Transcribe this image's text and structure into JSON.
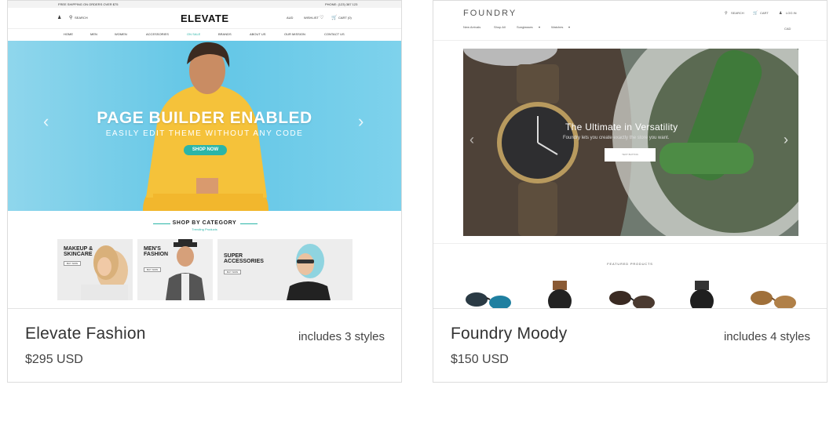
{
  "themes": [
    {
      "name": "Elevate Fashion",
      "price": "$295 USD",
      "styles": "includes 3 styles",
      "preview": {
        "topbar_left": "FREE SHIPPING ON ORDERS OVER $75",
        "topbar_right": "PHONE: (123) 387 123",
        "search_label": "SEARCH",
        "logo": "ELEVATE",
        "currency": "AUD",
        "wishlist": "WISHLIST",
        "cart": "CART (0)",
        "nav": [
          "HOME",
          "MEN",
          "WOMEN",
          "ACCESSORIES",
          "ON SALE",
          "BRANDS",
          "ABOUT US",
          "OUR MISSION",
          "CONTACT US"
        ],
        "hero_title": "PAGE BUILDER ENABLED",
        "hero_subtitle": "EASILY EDIT THEME WITHOUT ANY CODE",
        "hero_button": "SHOP NOW",
        "category_title": "SHOP BY CATEGORY",
        "category_subtitle": "Trending Products",
        "categories": [
          {
            "title_line1": "MAKEUP &",
            "title_line2": "SKINCARE",
            "button": "BUY NOW"
          },
          {
            "title_line1": "MEN'S",
            "title_line2": "FASHION",
            "button": "BUY NOW"
          },
          {
            "title_line1": "SUPER",
            "title_line2": "ACCESSORIES",
            "button": "BUY NOW"
          }
        ],
        "accent_color": "#2bb5a8"
      }
    },
    {
      "name": "Foundry Moody",
      "price": "$150 USD",
      "styles": "includes 4 styles",
      "preview": {
        "logo": "FOUNDRY",
        "nav": [
          "New Arrivals",
          "Shop All",
          "Sunglasses",
          "Watches"
        ],
        "search": "SEARCH",
        "cart": "CART",
        "login": "LOG IN",
        "currency": "CAD",
        "hero_title": "The Ultimate in Versatility",
        "hero_subtitle": "Foundry lets you create exactly the store you want.",
        "hero_button": "TEXT BUTTON",
        "featured_label": "FEATURED PRODUCTS",
        "products": [
          "sunglasses",
          "watch",
          "sunglasses",
          "watch",
          "sunglasses"
        ]
      }
    }
  ]
}
